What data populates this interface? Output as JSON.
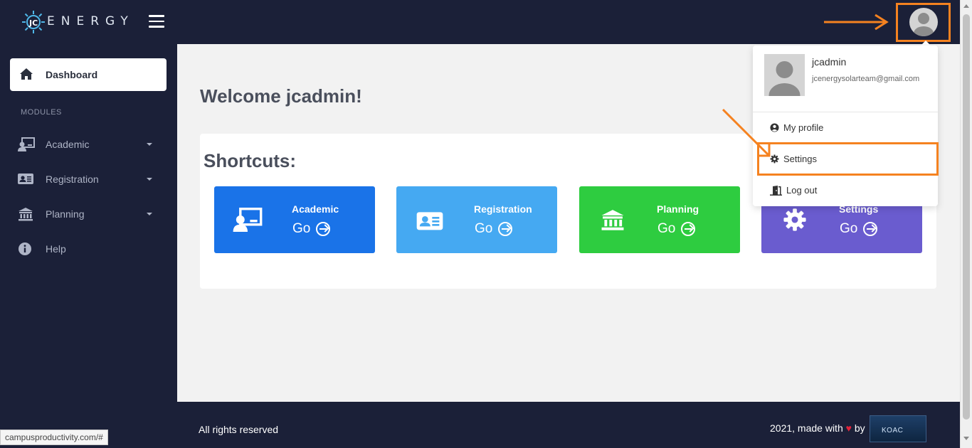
{
  "app": {
    "logo_text": "ENERGY"
  },
  "header": {
    "menu_icon": "hamburger-icon",
    "avatar_icon": "user-avatar-icon"
  },
  "sidebar": {
    "active_item": {
      "label": "Dashboard",
      "icon": "home-icon"
    },
    "section_label": "MODULES",
    "items": [
      {
        "label": "Academic",
        "icon": "teacher-board-icon",
        "has_submenu": true
      },
      {
        "label": "Registration",
        "icon": "id-card-icon",
        "has_submenu": true
      },
      {
        "label": "Planning",
        "icon": "building-columns-icon",
        "has_submenu": true
      },
      {
        "label": "Help",
        "icon": "info-circle-icon",
        "has_submenu": false
      }
    ]
  },
  "main": {
    "welcome": "Welcome jcadmin!",
    "shortcuts_title": "Shortcuts:",
    "tiles": [
      {
        "label": "Academic",
        "go": "Go",
        "color": "#1a73e8",
        "icon": "teacher-board-icon"
      },
      {
        "label": "Registration",
        "go": "Go",
        "color": "#45a9f2",
        "icon": "id-card-icon"
      },
      {
        "label": "Planning",
        "go": "Go",
        "color": "#2ecc40",
        "icon": "building-columns-icon"
      },
      {
        "label": "Settings",
        "go": "Go",
        "color": "#6a5ccf",
        "icon": "gear-icon"
      }
    ]
  },
  "dropdown": {
    "username": "jcadmin",
    "email": "jcenergysolarteam@gmail.com",
    "items": [
      {
        "label": "My profile",
        "icon": "user-circle-icon"
      },
      {
        "label": "Settings",
        "icon": "gear-icon"
      },
      {
        "label": "Log out",
        "icon": "door-exit-icon"
      }
    ]
  },
  "footer": {
    "left_text": "All rights reserved",
    "right_prefix": "2021, made with",
    "right_suffix": "by",
    "sponsor_logo_text": "KOAC"
  },
  "status_bar": {
    "url": "campusproductivity.com/#"
  },
  "colors": {
    "navy": "#1b2038",
    "accent_highlight": "#f58220"
  }
}
